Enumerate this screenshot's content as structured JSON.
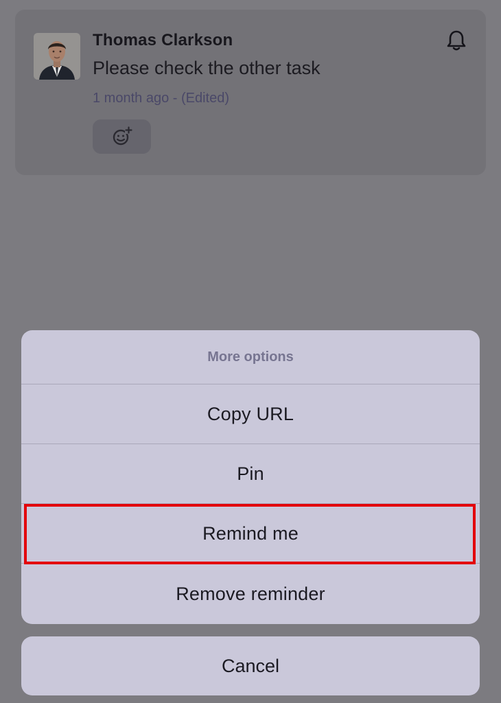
{
  "comment": {
    "author": "Thomas Clarkson",
    "message": "Please check the other task",
    "meta": "1 month ago - (Edited)",
    "reaction_icon": "add-reaction-icon",
    "notification_icon": "bell-icon"
  },
  "action_sheet": {
    "title": "More options",
    "items": [
      {
        "label": "Copy URL"
      },
      {
        "label": "Pin"
      },
      {
        "label": "Remind me",
        "highlighted": true
      },
      {
        "label": "Remove reminder"
      }
    ],
    "cancel_label": "Cancel"
  },
  "colors": {
    "highlight": "#e3020a",
    "sheet_background": "#cac8da",
    "overlay": "#7c7b80"
  }
}
